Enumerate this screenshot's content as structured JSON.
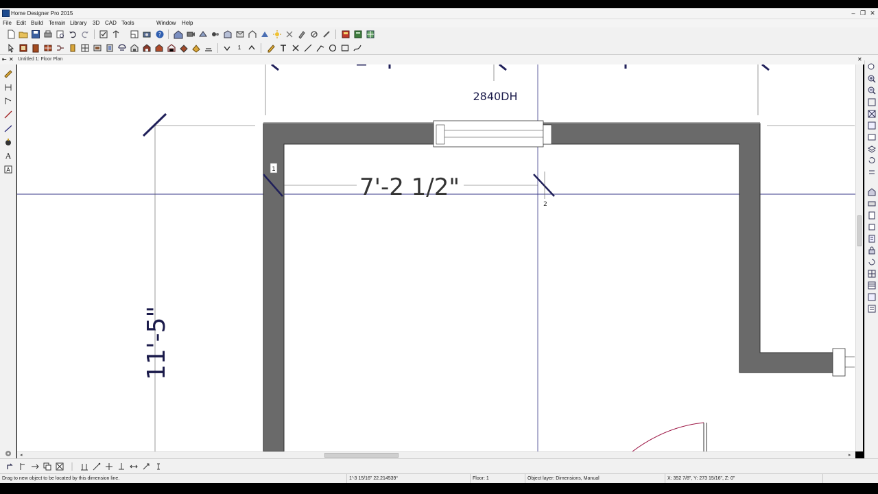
{
  "window": {
    "title": "Home Designer Pro 2015",
    "controls": [
      "–",
      "❐",
      "✕"
    ]
  },
  "menu": [
    "File",
    "Edit",
    "Build",
    "Terrain",
    "Library",
    "3D",
    "CAD",
    "Tools",
    "Window",
    "Help"
  ],
  "document": {
    "title": "Untitled 1: Floor Plan",
    "pin_glyph": "⇤",
    "close_glyph": "✕"
  },
  "toolbar_row1_icons": [
    "new-file-icon",
    "open-folder-icon",
    "save-icon",
    "print-icon",
    "print-preview-icon",
    "undo-icon",
    "redo-icon",
    "select-objects-icon",
    "fill-window-icon",
    "floor-plan-view-icon",
    "camera-icon",
    "help-icon",
    "house-icon",
    "camera-view-icon",
    "overview-icon",
    "cross-section-icon",
    "elevation-icon",
    "perspective-icon",
    "framing-icon",
    "sun-icon",
    "material-icon",
    "delete-icon",
    "paint-icon",
    "edit-icon",
    "window-tile-icon",
    "palette-icon",
    "library-icon"
  ],
  "toolbar_row2_icons": [
    "select-arrow-icon",
    "build-wall-icon",
    "door-icon",
    "window-icon",
    "cabinet-icon",
    "stairs-icon",
    "room-icon",
    "roof-icon",
    "wall-type-icon",
    "dormer-icon",
    "fireplace-icon",
    "fixture-icon",
    "framing-tool-icon",
    "terrain-icon",
    "sidewalk-icon",
    "plant-icon",
    "check-icon",
    "floor-number-icon",
    "up-arrow-icon",
    "pencil-icon",
    "text-icon",
    "close-x-icon",
    "line-icon",
    "arc-icon",
    "circle-icon",
    "rectangle-icon",
    "spline-icon"
  ],
  "toolbar_row2_floor_value": "1",
  "canvas": {
    "dim_top_label": "7'-2 1/2\"",
    "dim_side_label": "11'-5\"",
    "window_label": "2840DH",
    "marker_1": "1",
    "marker_2": "2"
  },
  "status": {
    "hint": "Drag to new object to be located by this dimension line.",
    "measure": "1'-3 15/16\" 22.214539°",
    "floor": "Floor: 1",
    "layer": "Object layer: Dimensions,  Manual",
    "coords": "X: 352 7/8\", Y: 273 15/16\", Z: 0\""
  },
  "colors": {
    "wall_fill": "#6a6a6a",
    "wall_edge": "#2e2e2e",
    "guide_line": "#3a3a88",
    "dimension_line": "#20205a",
    "canvas_bg": "#ffffff",
    "chrome_bg": "#f1f1f1",
    "door_swing": "#9a1040"
  }
}
